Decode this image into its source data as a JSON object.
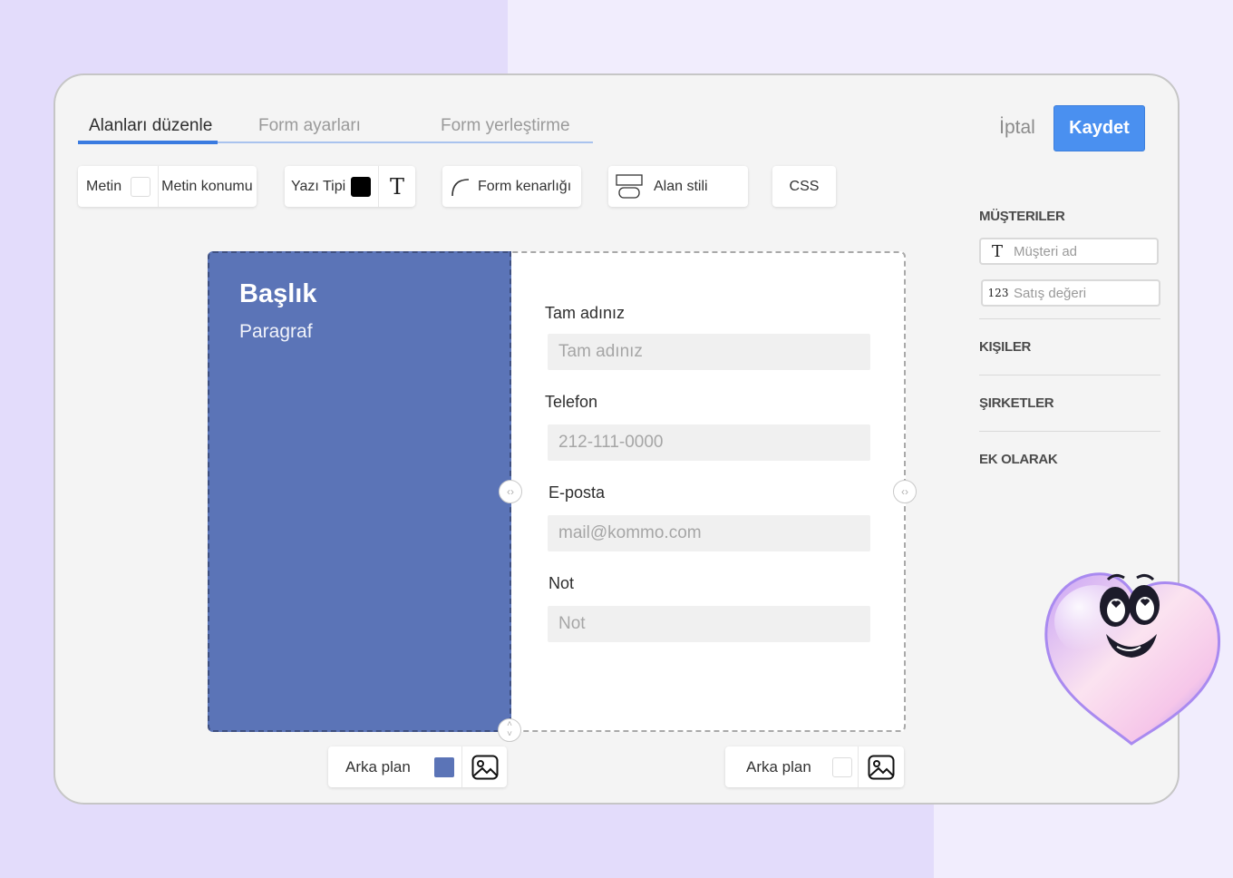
{
  "tabs": [
    {
      "label": "Alanları düzenle",
      "active": true
    },
    {
      "label": "Form ayarları",
      "active": false
    },
    {
      "label": "Form yerleştirme",
      "active": false
    }
  ],
  "actions": {
    "cancel": "İptal",
    "save": "Kaydet"
  },
  "toolbar": {
    "text": "Metin",
    "text_position": "Metin konumu",
    "font": "Yazı Tipi",
    "form_border": "Form kenarlığı",
    "field_style": "Alan stili",
    "css": "CSS"
  },
  "left_pane": {
    "heading": "Başlık",
    "paragraph": "Paragraf",
    "color": "#5b74b7"
  },
  "fields": [
    {
      "label": "Tam adınız",
      "placeholder": "Tam adınız"
    },
    {
      "label": "Telefon",
      "placeholder": "212-111-0000"
    },
    {
      "label": "E-posta",
      "placeholder": "mail@kommo.com"
    },
    {
      "label": "Not",
      "placeholder": "Not"
    }
  ],
  "background_controls": {
    "left_label": "Arka plan",
    "right_label": "Arka plan"
  },
  "sidebar": {
    "sections": [
      "MÜŞTERILER",
      "KIŞILER",
      "ŞIRKETLER",
      "EK OLARAK"
    ],
    "customer_fields": [
      {
        "icon": "T",
        "label": "Müşteri ad"
      },
      {
        "icon": "123",
        "label": "Satış değeri"
      }
    ]
  },
  "colors": {
    "accent": "#4a90f0",
    "pane": "#5b74b7"
  }
}
